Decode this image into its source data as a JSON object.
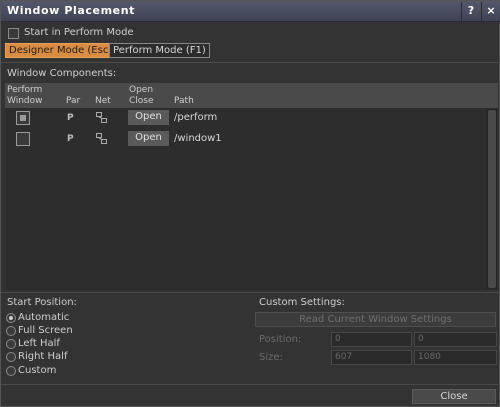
{
  "window": {
    "title": "Window Placement",
    "help_label": "?",
    "close_label": "×"
  },
  "start_perform": {
    "label": "Start in Perform Mode",
    "checked": false
  },
  "modes": {
    "designer_label": "Designer Mode (Esc)",
    "perform_label": "Perform Mode (F1)",
    "active": "designer"
  },
  "components": {
    "section_label": "Window Components:",
    "headers": {
      "perform_line1": "Perform",
      "perform_line2": "Window",
      "par": "Par",
      "net": "Net",
      "open_line1": "Open",
      "open_line2": "Close",
      "path": "Path"
    },
    "rows": [
      {
        "checked": true,
        "par": "P",
        "net_icon": "network-icon",
        "open_label": "Open",
        "path": "/perform"
      },
      {
        "checked": false,
        "par": "P",
        "net_icon": "network-icon",
        "open_label": "Open",
        "path": "/window1"
      }
    ]
  },
  "start_position": {
    "label": "Start Position:",
    "options": [
      "Automatic",
      "Full Screen",
      "Left Half",
      "Right Half",
      "Custom"
    ],
    "selected": "Automatic"
  },
  "custom_settings": {
    "label": "Custom Settings:",
    "read_button": "Read Current Window Settings",
    "position_label": "Position:",
    "position_x": "0",
    "position_y": "0",
    "size_label": "Size:",
    "size_w": "607",
    "size_h": "1080"
  },
  "footer": {
    "close_label": "Close"
  },
  "colors": {
    "active_mode": "#d98c42",
    "titlebar": "#4a4f60",
    "background": "#333333"
  }
}
